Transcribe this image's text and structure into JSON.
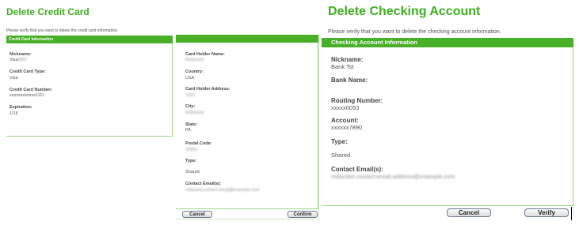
{
  "credit_card_panel": {
    "title": "Delete Credit Card",
    "intro": "Please verify that you want to delete the credit card information.",
    "section_header": "Credit Card Information",
    "fields": [
      {
        "label": "Nickname:",
        "value": "Visa"
      },
      {
        "label": "Credit Card Type:",
        "value": "Visa"
      },
      {
        "label": "Credit Card Number:",
        "value": "xxxxxxxxxxxx1111"
      },
      {
        "label": "Expiration:",
        "value": "1/15"
      }
    ]
  },
  "card_holder_panel": {
    "fields": [
      {
        "label": "Card Holder Name:",
        "value": ""
      },
      {
        "label": "Country:",
        "value": "USA"
      },
      {
        "label": "Card Holder Address:",
        "value": ""
      },
      {
        "label": "City:",
        "value": ""
      },
      {
        "label": "State:",
        "value": "PA"
      },
      {
        "label": "Postal Code:",
        "value": ""
      },
      {
        "label": "Type:",
        "value": "Shared"
      },
      {
        "label": "Contact Email(s):",
        "value": ""
      }
    ],
    "cancel_label": "Cancel",
    "confirm_label": "Confirm"
  },
  "checking_panel": {
    "title": "Delete Checking Account",
    "intro": "Please verify that you want to delete the checking account information.",
    "section_header": "Checking Account Information",
    "fields": [
      {
        "label": "Nickname:",
        "value": "Bank Tst"
      },
      {
        "label": "Bank Name:",
        "value": ""
      },
      {
        "label": "Routing Number:",
        "value": "xxxxx0053"
      },
      {
        "label": "Account:",
        "value": "xxxxxx7890"
      },
      {
        "label": "Type:",
        "value": "Shared"
      },
      {
        "label": "Contact Email(s):",
        "value": ""
      }
    ],
    "cancel_label": "Cancel",
    "verify_label": "Verify"
  },
  "colors": {
    "accent_green": "#48b027",
    "title_green": "#3fae1f"
  }
}
